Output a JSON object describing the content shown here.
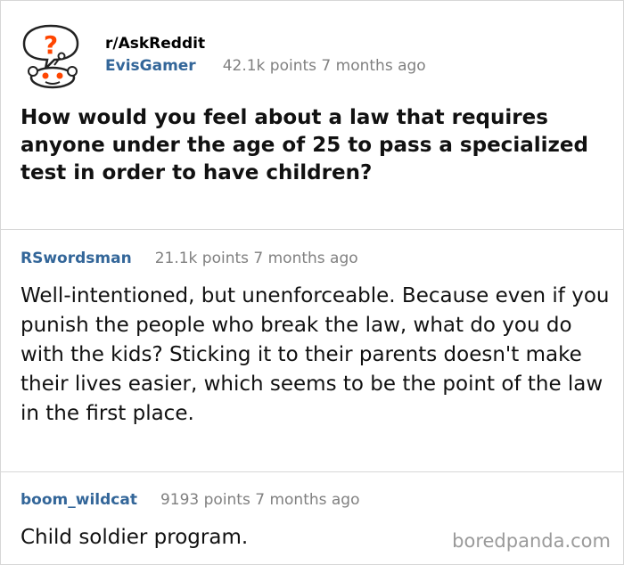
{
  "post": {
    "subreddit": "r/AskReddit",
    "author": "EvisGamer",
    "meta": "42.1k points 7 months ago",
    "title": "How would you feel about a law that requires anyone under the age of 25 to pass a specialized test in order to have children?"
  },
  "comments": [
    {
      "author": "RSwordsman",
      "meta": "21.1k points 7 months ago",
      "body": "Well-intentioned, but unenforceable. Because even if you punish the people who break the law, what do you do with the kids? Sticking it to their parents doesn't make their lives easier, which seems to be the point of the law in the first place."
    },
    {
      "author": "boom_wildcat",
      "meta": "9193 points 7 months ago",
      "body": "Child soldier program."
    }
  ],
  "watermark": "boredpanda.com",
  "icons": {
    "logo": "reddit-askreddit-logo-icon"
  },
  "colors": {
    "username": "#336699",
    "meta": "#808080",
    "accent": "#ff4500"
  }
}
